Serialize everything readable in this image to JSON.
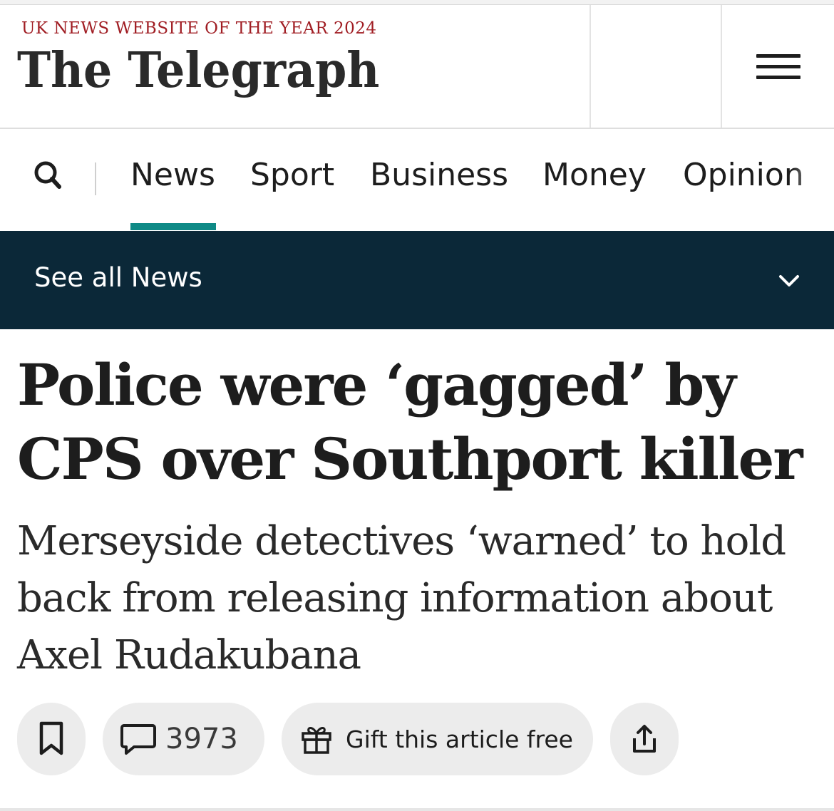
{
  "masthead": {
    "award": "UK NEWS WEBSITE OF THE YEAR 2024",
    "logo": "The Telegraph"
  },
  "nav": {
    "tabs": [
      "News",
      "Sport",
      "Business",
      "Money",
      "Opinion"
    ],
    "active_tab": "News"
  },
  "subnav": {
    "label": "See all News"
  },
  "article": {
    "headline": "Police were ‘gagged’ by CPS over Southport killer",
    "standfirst": "Merseyside detectives ‘warned’ to hold back from releasing information about Axel Rudakubana"
  },
  "actions": {
    "comment_count": "3973",
    "gift_label": "Gift this article free"
  },
  "colors": {
    "accent": "#0f8a86",
    "subnav_bg": "#0b2838",
    "award_red": "#a01d23",
    "pill_bg": "#ececec"
  },
  "icons": [
    "search-icon",
    "menu-icon",
    "chevron-down-icon",
    "bookmark-icon",
    "comment-icon",
    "gift-icon",
    "share-icon"
  ]
}
